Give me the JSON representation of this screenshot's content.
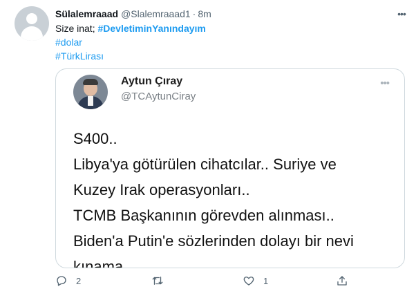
{
  "tweet": {
    "display_name": "Sülalemraaad",
    "handle": "@Slalemraaad1",
    "separator": "·",
    "time": "8m",
    "text_line1_prefix": "Size inat;",
    "hashtag1": "#DevletiminYanındayım",
    "hashtag2": "#dolar",
    "hashtag3": "#TürkLirası",
    "more_icon": "more-icon"
  },
  "quoted_image": {
    "author_name": "Aytun Çıray",
    "author_handle": "@TCAytunCiray",
    "lines": [
      "S400..",
      "Libya'ya götürülen cihatcılar.. Suriye ve",
      "Kuzey Irak operasyonları..",
      "TCMB Başkanının görevden alınması..",
      "Biden'a Putin'e sözlerinden dolayı bir nevi",
      "kınama.."
    ]
  },
  "actions": {
    "reply_count": "2",
    "retweet_count": "",
    "like_count": "1",
    "share_count": ""
  },
  "colors": {
    "link": "#1d9bf0",
    "secondary": "#536471",
    "border": "#cfd9de"
  }
}
